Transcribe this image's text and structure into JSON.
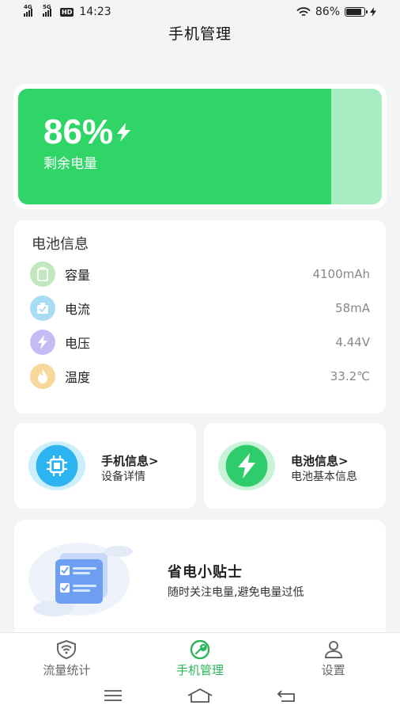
{
  "status_bar": {
    "network_1": "4G",
    "network_2": "5G",
    "hd": "HD",
    "time": "14:23",
    "battery_pct": "86%"
  },
  "page_title": "手机管理",
  "battery": {
    "percent_text": "86%",
    "level": 0.86,
    "label": "剩余电量",
    "colors": {
      "fill": "#2fd667",
      "track": "#a8ecc1"
    }
  },
  "battery_info": {
    "title": "电池信息",
    "rows": [
      {
        "icon": "battery-capacity-icon",
        "label": "容量",
        "value": "4100mAh",
        "color": "#bfe8bf"
      },
      {
        "icon": "current-icon",
        "label": "电流",
        "value": "58mA",
        "color": "#a8dcf4"
      },
      {
        "icon": "voltage-icon",
        "label": "电压",
        "value": "4.44V",
        "color": "#c3bdf3"
      },
      {
        "icon": "temperature-icon",
        "label": "温度",
        "value": "33.2℃",
        "color": "#f7d79a"
      }
    ]
  },
  "cards": {
    "phone_info": {
      "title": "手机信息>",
      "subtitle": "设备详情",
      "icon": "chip-icon",
      "color": "#2bb4f0"
    },
    "battery_info": {
      "title": "电池信息>",
      "subtitle": "电池基本信息",
      "icon": "lightning-icon",
      "color": "#2ecc6a"
    }
  },
  "tips": {
    "title": "省电小贴士",
    "subtitle": "随时关注电量,避免电量过低",
    "illustration": "checklist-illustration"
  },
  "tabs": [
    {
      "label": "流量统计",
      "icon": "wifi-shield-icon",
      "active": false
    },
    {
      "label": "手机管理",
      "icon": "wrench-icon",
      "active": true
    },
    {
      "label": "设置",
      "icon": "user-icon",
      "active": false
    }
  ],
  "accent_color": "#2bb55a"
}
